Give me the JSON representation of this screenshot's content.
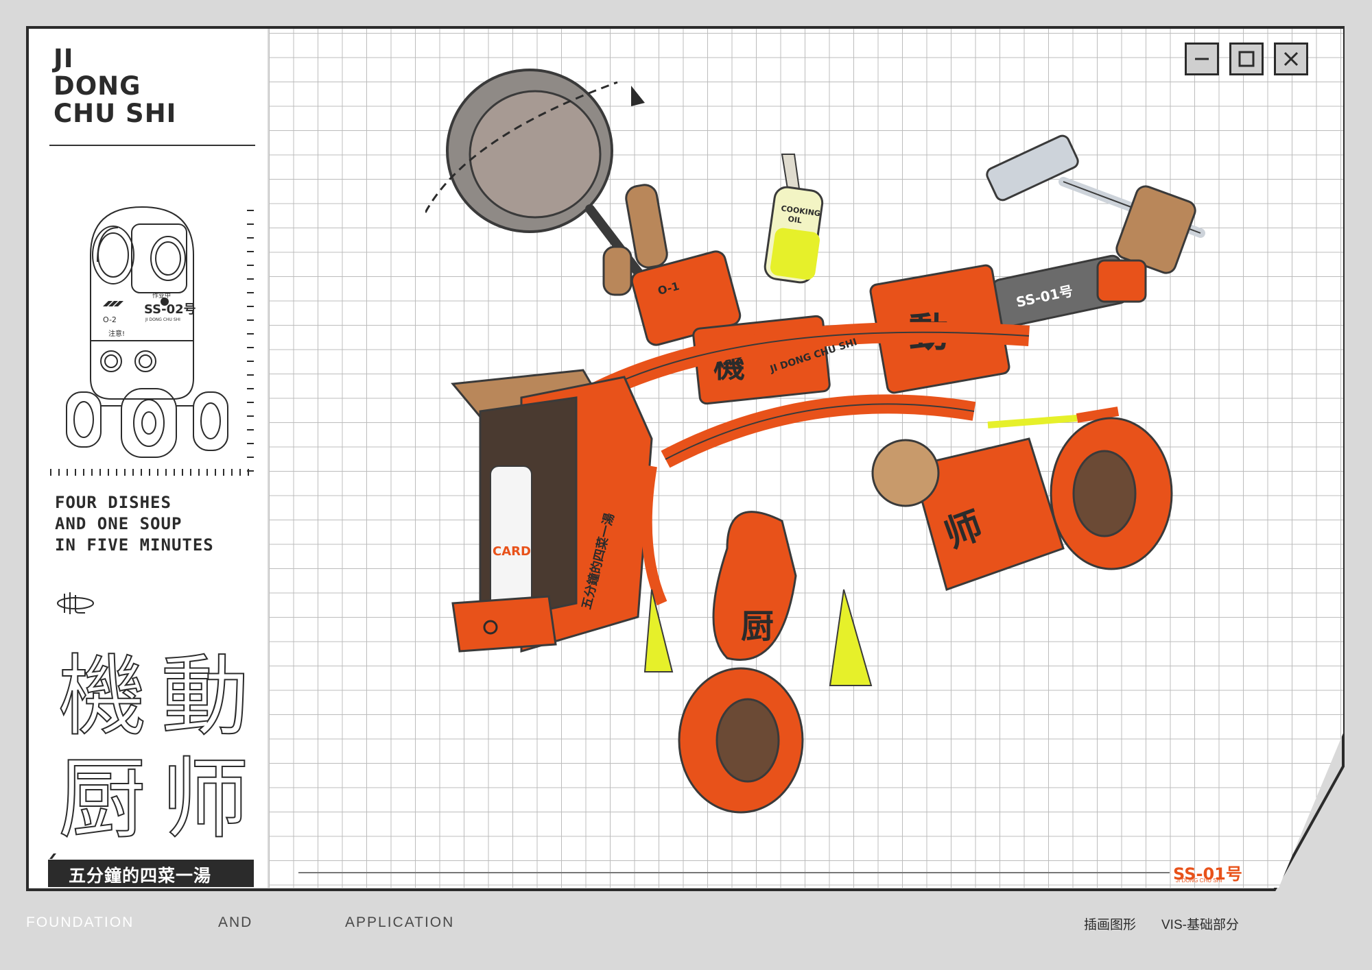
{
  "sidebar": {
    "brand_lines": [
      "JI",
      "DONG",
      "CHU SHI"
    ],
    "tagline_lines": [
      "FOUR DISHES",
      "AND ONE SOUP",
      "IN FIVE MINUTES"
    ],
    "big_chars": [
      "機",
      "動",
      "厨",
      "师"
    ],
    "banner": "五分鐘的四菜一湯",
    "robot_label": "SS-02号",
    "robot_sub": "JI DONG CHU SHI",
    "robot_tag": "O-2",
    "robot_warning": "注意!",
    "robot_status": "作业中"
  },
  "window_controls": {
    "minimize_icon": "minimize-icon",
    "maximize_icon": "maximize-icon",
    "close_icon": "close-icon"
  },
  "illustration": {
    "chars": [
      "機",
      "動",
      "厨",
      "师"
    ],
    "cooking_oil": [
      "COOKING",
      "OIL"
    ],
    "card_label": "CARD",
    "panel_text": "五分鐘的四菜一湯",
    "arm_band": "JI DONG CHU SHI",
    "shoulder_label": "SS-01号",
    "unit_tag": "O-1"
  },
  "model_tag": {
    "label": "SS-01号",
    "sub": "JI DONG CHU SHI"
  },
  "footer": {
    "foundation": "FOUNDATION",
    "and": "AND",
    "application": "APPLICATION",
    "section_cn": "插画图形",
    "vis_cn": "VIS-基础部分"
  },
  "colors": {
    "accent_orange": "#e8521a",
    "dark": "#2b2b2b",
    "lime": "#e6f02a",
    "bronze": "#b9875a",
    "background": "#d9d9d9"
  }
}
